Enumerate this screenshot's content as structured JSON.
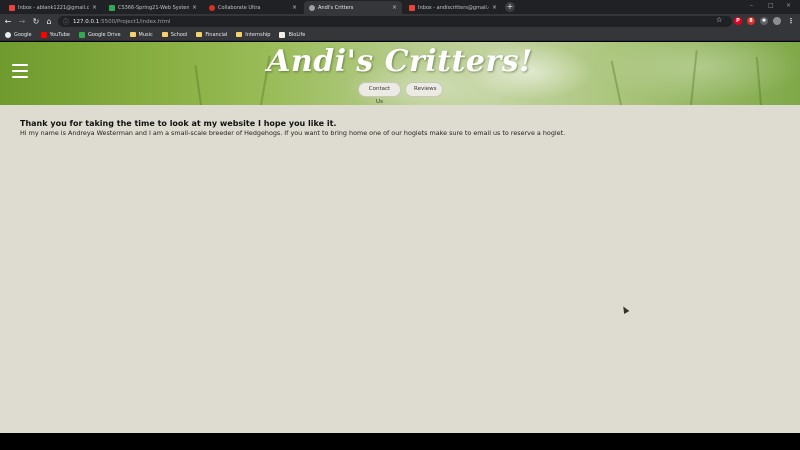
{
  "browser": {
    "tabs": [
      {
        "title": "Inbox - ablank1221@gmail.com",
        "favicon": "gmail-icon",
        "color": "#ea4335",
        "active": false
      },
      {
        "title": "CS366-Spring21-Web Systems",
        "favicon": "drive-icon",
        "color": "#34a853",
        "active": false
      },
      {
        "title": "Collaborate Ultra",
        "favicon": "collaborate-icon",
        "color": "#d93025",
        "active": false
      },
      {
        "title": "Andi's Critters",
        "favicon": "globe-icon",
        "color": "#9aa0a6",
        "active": true
      },
      {
        "title": "Inbox - andiscritters@gmail.com",
        "favicon": "gmail-icon",
        "color": "#ea4335",
        "active": false
      }
    ],
    "new_tab_label": "+",
    "window_controls": {
      "minimize": "–",
      "maximize": "□",
      "close": "×"
    },
    "url_host": "127.0.0.1",
    "url_rest": ":5500/Project1/index.html",
    "nav_glyphs": {
      "back": "←",
      "forward": "→",
      "reload": "↻",
      "home": "⌂"
    },
    "extensions": [
      {
        "name": "pinterest-icon",
        "label": "P",
        "color": "#e60023"
      },
      {
        "name": "badge-icon",
        "label": "8",
        "color": "#d93025"
      },
      {
        "name": "puzzle-icon",
        "label": "✱",
        "color": "#5f6368"
      }
    ],
    "bookmarks": [
      {
        "label": "Google",
        "icon": "google-icon",
        "color": "#e8eaed"
      },
      {
        "label": "YouTube",
        "icon": "youtube-icon",
        "color": "#ff0000"
      },
      {
        "label": "Google Drive",
        "icon": "drive-icon",
        "color": "#34a853"
      },
      {
        "label": "Music",
        "icon": "folder-icon",
        "color": "#f6d26a"
      },
      {
        "label": "School",
        "icon": "folder-icon",
        "color": "#f6d26a"
      },
      {
        "label": "Financial",
        "icon": "folder-icon",
        "color": "#f6d26a"
      },
      {
        "label": "Internship",
        "icon": "folder-icon",
        "color": "#f6d26a"
      },
      {
        "label": "BioLife",
        "icon": "biolife-icon",
        "color": "#f2f0e6"
      }
    ]
  },
  "site": {
    "brand": "Andi's Critters!",
    "nav": {
      "contact": "Contact Us",
      "reviews": "Reviews"
    },
    "heading": "Thank you for taking the time to look at my website I hope you like it.",
    "body": "Hi my name is Andreya Westerman and I am a small-scale breeder of Hedgehogs. If you want to bring home one of our hoglets make sure to email us to reserve a hoglet."
  }
}
